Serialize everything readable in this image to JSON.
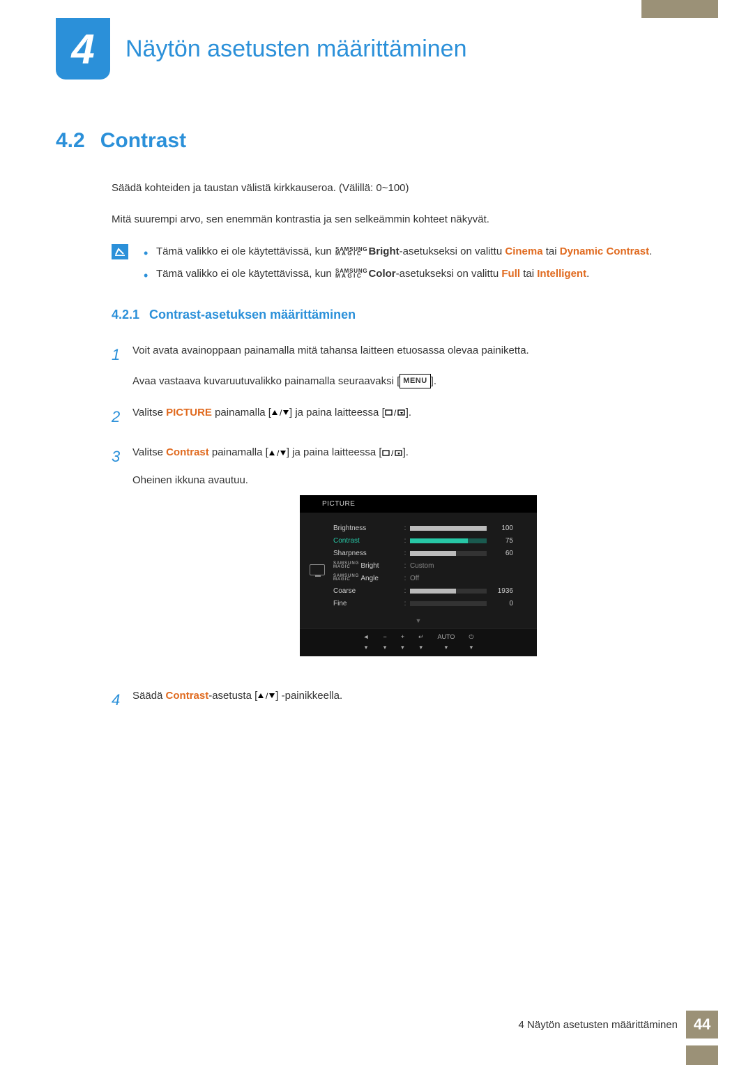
{
  "header": {
    "chapter_number": "4",
    "chapter_title": "Näytön asetusten määrittäminen"
  },
  "section": {
    "number": "4.2",
    "title": "Contrast",
    "intro1": "Säädä kohteiden ja taustan välistä kirkkauseroa. (Välillä: 0~100)",
    "intro2": "Mitä suurempi arvo, sen enemmän kontrastia ja sen selkeämmin kohteet näkyvät."
  },
  "notes": {
    "n1_a": "Tämä valikko ei ole käytettävissä, kun ",
    "n1_b": "Bright",
    "n1_c": "-asetukseksi on valittu ",
    "n1_d": "Cinema",
    "n1_e": " tai ",
    "n1_f": "Dynamic Contrast",
    "n1_g": ".",
    "n2_a": "Tämä valikko ei ole käytettävissä, kun ",
    "n2_b": "Color",
    "n2_c": "-asetukseksi on valittu ",
    "n2_d": "Full",
    "n2_e": " tai ",
    "n2_f": "Intelligent",
    "n2_g": "."
  },
  "magic": {
    "line1": "SAMSUNG",
    "line2": "MAGIC"
  },
  "subsection": {
    "number": "4.2.1",
    "title": "Contrast-asetuksen määrittäminen"
  },
  "steps": {
    "s1n": "1",
    "s1a": "Voit avata avainoppaan painamalla mitä tahansa laitteen etuosassa olevaa painiketta.",
    "s1b": "Avaa vastaava kuvaruutuvalikko painamalla seuraavaksi [",
    "s1c": "].",
    "menu_key": "MENU",
    "s2n": "2",
    "s2a": "Valitse ",
    "s2b": "PICTURE",
    "s2c": " painamalla [",
    "s2d": "] ja paina laitteessa [",
    "s2e": "].",
    "s3n": "3",
    "s3a": "Valitse ",
    "s3b": "Contrast",
    "s3c": " painamalla [",
    "s3d": "] ja paina laitteessa [",
    "s3e": "].",
    "s3f": "Oheinen ikkuna avautuu.",
    "s4n": "4",
    "s4a": "Säädä ",
    "s4b": "Contrast",
    "s4c": "-asetusta [",
    "s4d": "] -painikkeella."
  },
  "osd": {
    "title": "PICTURE",
    "rows": [
      {
        "label": "Brightness",
        "value": "100",
        "fill": 100,
        "bar": true
      },
      {
        "label": "Contrast",
        "value": "75",
        "fill": 75,
        "bar": true,
        "selected": true
      },
      {
        "label": "Sharpness",
        "value": "60",
        "fill": 60,
        "bar": true
      },
      {
        "label": "Bright",
        "value": "Custom",
        "bar": false,
        "magic": true
      },
      {
        "label": "Angle",
        "value": "Off",
        "bar": false,
        "magic": true
      },
      {
        "label": "Coarse",
        "value": "1936",
        "fill": 60,
        "bar": true
      },
      {
        "label": "Fine",
        "value": "0",
        "fill": 0,
        "bar": true
      }
    ],
    "footer_auto": "AUTO"
  },
  "footer": {
    "text": "4 Näytön asetusten määrittäminen",
    "page": "44"
  }
}
